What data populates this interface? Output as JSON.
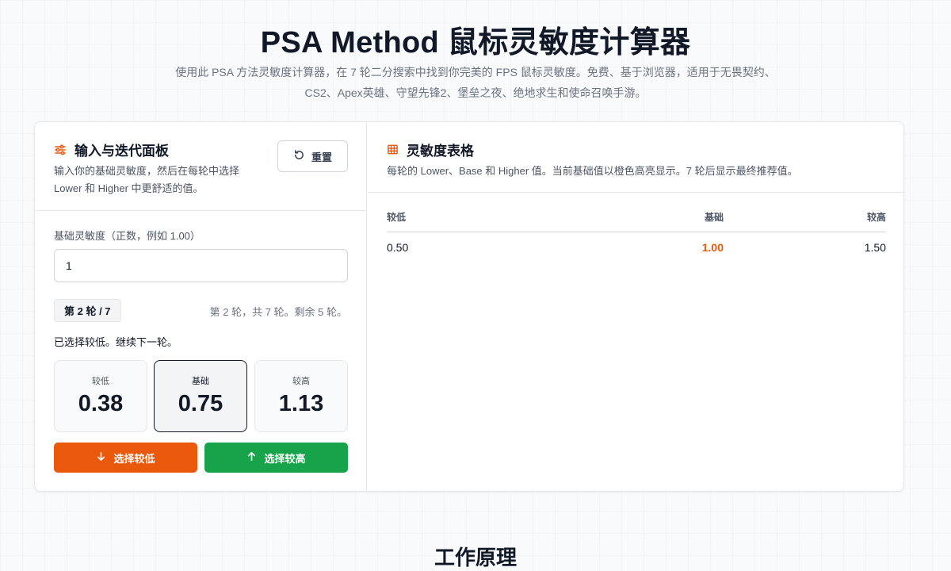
{
  "header": {
    "title": "PSA Method 鼠标灵敏度计算器",
    "subtitle": "使用此 PSA 方法灵敏度计算器，在 7 轮二分搜索中找到你完美的 FPS 鼠标灵敏度。免费、基于浏览器，适用于无畏契约、CS2、Apex英雄、守望先锋2、堡垒之夜、绝地求生和使命召唤手游。"
  },
  "input_panel": {
    "icon": "sliders-icon",
    "title": "输入与迭代面板",
    "description": "输入你的基础灵敏度，然后在每轮中选择 Lower 和 Higher 中更舒适的值。",
    "reset_label": "重置",
    "reset_icon": "reset-icon",
    "field_label": "基础灵敏度（正数，例如 1.00）",
    "field_value": "1",
    "round_badge": "第 2 轮 / 7",
    "round_info": "第 2 轮，共 7 轮。剩余 5 轮。",
    "status": "已选择较低。继续下一轮。",
    "values": {
      "lower": {
        "label": "较低",
        "value": "0.38"
      },
      "base": {
        "label": "基础",
        "value": "0.75"
      },
      "higher": {
        "label": "较高",
        "value": "1.13"
      }
    },
    "btn_lower": "选择较低",
    "btn_higher": "选择较高",
    "colors": {
      "lower": "#ea580c",
      "higher": "#16a34a",
      "accent": "#ea580c"
    }
  },
  "table_panel": {
    "icon": "table-icon",
    "title": "灵敏度表格",
    "description": "每轮的 Lower、Base 和 Higher 值。当前基础值以橙色高亮显示。7 轮后显示最终推荐值。",
    "columns": [
      "较低",
      "基础",
      "较高"
    ],
    "rows": [
      [
        "0.50",
        "1.00",
        "1.50"
      ]
    ]
  },
  "section": {
    "title": "工作原理"
  }
}
